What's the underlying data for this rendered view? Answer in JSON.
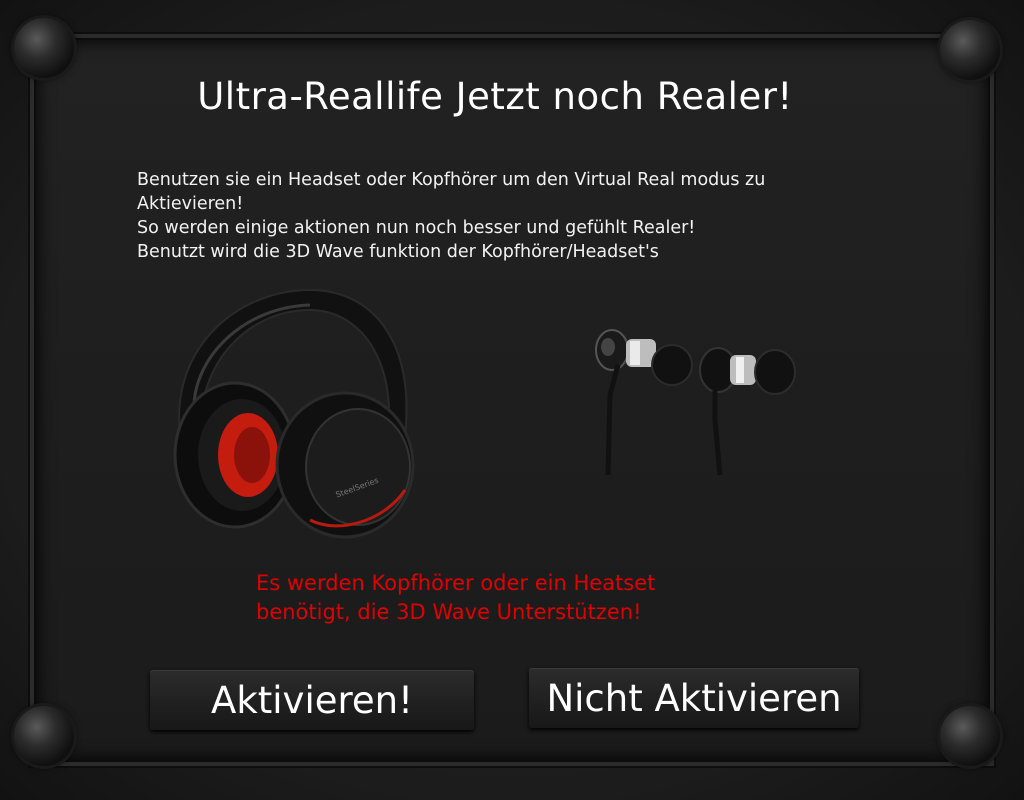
{
  "dialog": {
    "title": "Ultra-Reallife Jetzt noch Realer!",
    "intro_lines": [
      "Benutzen sie ein Headset oder Kopfhörer um den Virtual Real modus zu",
      "Aktievieren!",
      "So werden einige aktionen nun noch besser und gefühlt Realer!",
      "Benutzt wird die 3D Wave funktion der Kopfhörer/Headset's"
    ],
    "warning_lines": [
      "Es werden Kopfhörer oder ein Heatset",
      "benötigt, die 3D Wave Unterstützen!"
    ],
    "images": {
      "headset_brand": "SteelSeries"
    }
  },
  "buttons": {
    "activate_label": "Aktivieren!",
    "deactivate_label": "Nicht Aktivieren"
  },
  "colors": {
    "warning": "#e00000",
    "text": "#ffffff",
    "panel": "#1e1e1e"
  }
}
